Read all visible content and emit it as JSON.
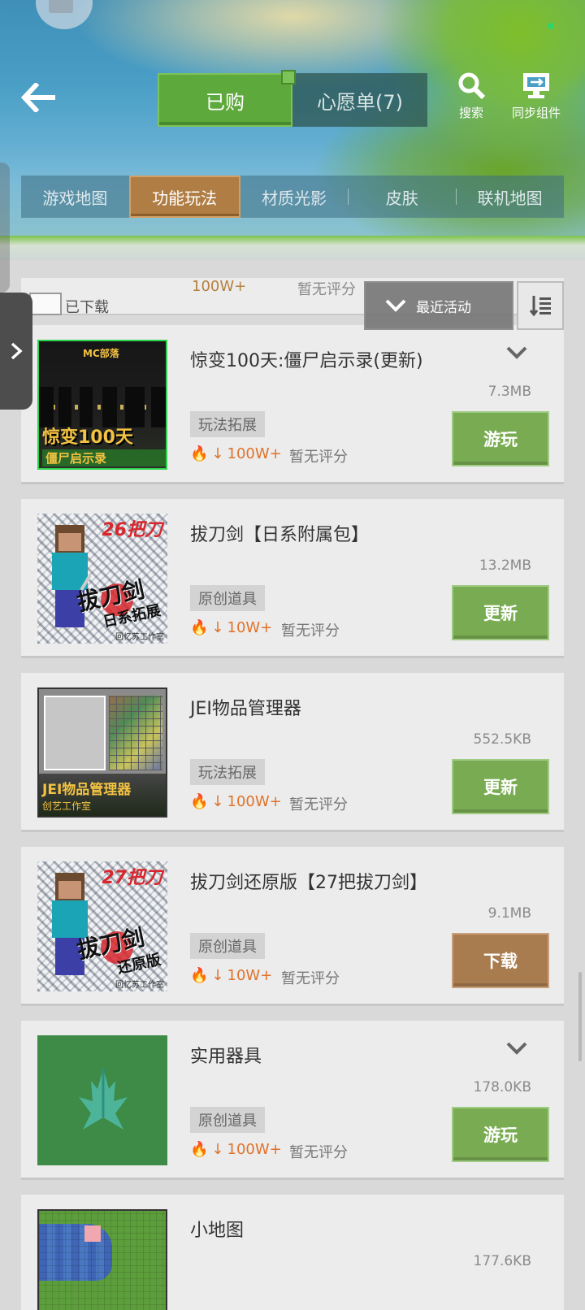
{
  "header": {
    "tabs": {
      "active": "已购",
      "inactive": "心愿单(7)"
    },
    "search_label": "搜索",
    "sync_label": "同步组件",
    "back_icon": "arrow-left-icon"
  },
  "categories": [
    "游戏地图",
    "功能玩法",
    "材质光影",
    "皮肤",
    "联机地图"
  ],
  "active_category": "功能玩法",
  "filter": {
    "downloaded_label": "已下载",
    "sort_label": "最近活动",
    "ghost_stats": "100W+",
    "ghost_rating": "暂无评分"
  },
  "items": [
    {
      "title": "惊变100天:僵尸启示录(更新)",
      "size": "7.3MB",
      "tag": "玩法拓展",
      "downloads": "100W+",
      "rating": "暂无评分",
      "action": "游玩",
      "action_color": "green",
      "has_chevron": true,
      "thumb": {
        "logo": "MC部落",
        "big": "惊变100天",
        "small": "僵尸启示录"
      }
    },
    {
      "title": "拔刀剑【日系附属包】",
      "size": "13.2MB",
      "tag": "原创道具",
      "downloads": "10W+",
      "rating": "暂无评分",
      "action": "更新",
      "action_color": "green",
      "has_chevron": false,
      "thumb": {
        "num": "26把刀",
        "big": "拔刀剑",
        "sub": "日系拓展",
        "studio": "回忆苏工作室"
      }
    },
    {
      "title": "JEI物品管理器",
      "size": "552.5KB",
      "tag": "玩法拓展",
      "downloads": "100W+",
      "rating": "暂无评分",
      "action": "更新",
      "action_color": "green",
      "has_chevron": false,
      "thumb": {
        "t1": "JEI物品管理器",
        "t2": "创艺工作室"
      }
    },
    {
      "title": "拔刀剑还原版【27把拔刀剑】",
      "size": "9.1MB",
      "tag": "原创道具",
      "downloads": "10W+",
      "rating": "暂无评分",
      "action": "下载",
      "action_color": "brown",
      "has_chevron": false,
      "thumb": {
        "num": "27把刀",
        "big": "拔刀剑",
        "sub": "还原版",
        "studio": "回忆苏工作室"
      }
    },
    {
      "title": "实用器具",
      "size": "178.0KB",
      "tag": "原创道具",
      "downloads": "100W+",
      "rating": "暂无评分",
      "action": "游玩",
      "action_color": "green",
      "has_chevron": true
    },
    {
      "title": "小地图",
      "size": "177.6KB"
    }
  ]
}
